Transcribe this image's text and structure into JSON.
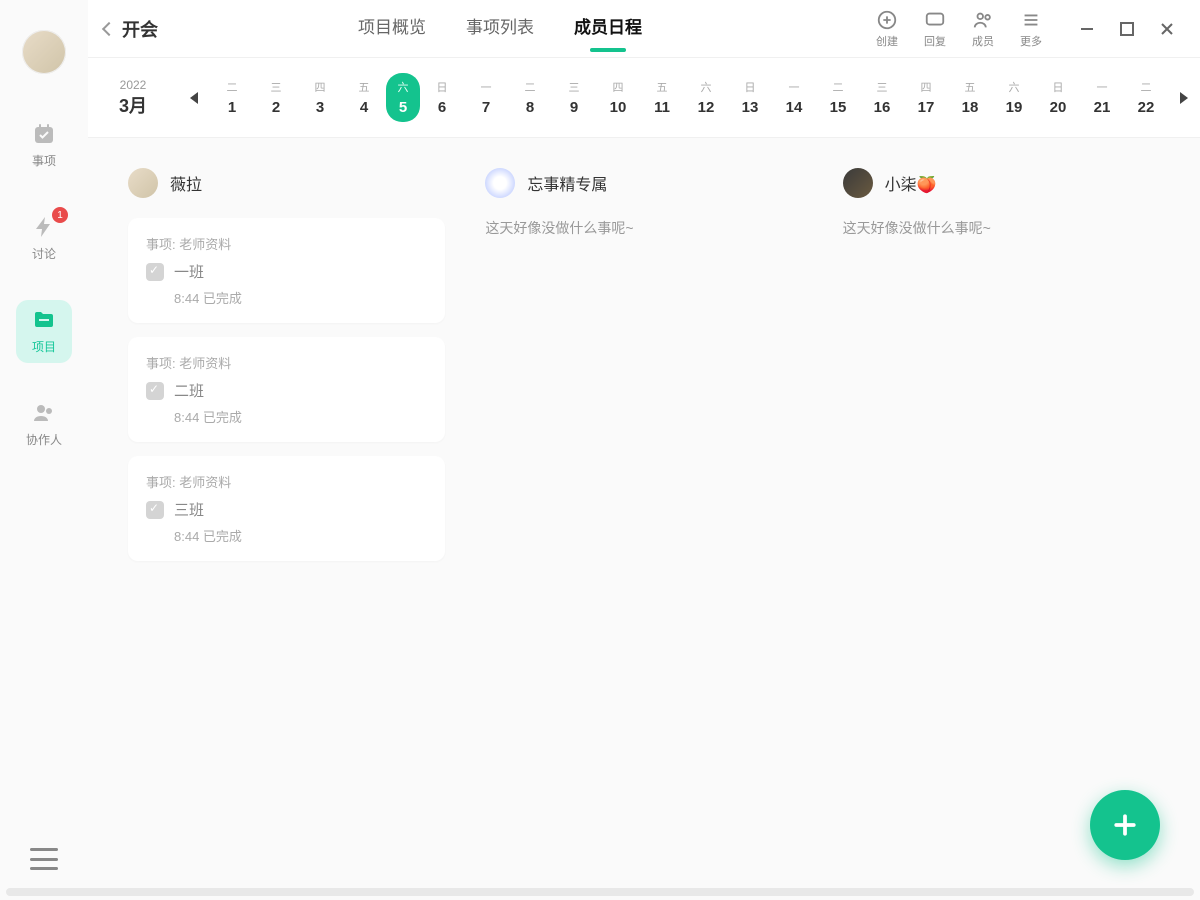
{
  "sidebar": {
    "items": [
      {
        "label": "事项"
      },
      {
        "label": "讨论",
        "badge": "1"
      },
      {
        "label": "项目"
      },
      {
        "label": "协作人"
      }
    ]
  },
  "header": {
    "title": "开会",
    "tabs": [
      "项目概览",
      "事项列表",
      "成员日程"
    ],
    "actions": [
      "创建",
      "回复",
      "成员",
      "更多"
    ]
  },
  "date": {
    "year": "2022",
    "month": "3月",
    "days": [
      {
        "dow": "二",
        "num": "1"
      },
      {
        "dow": "三",
        "num": "2"
      },
      {
        "dow": "四",
        "num": "3"
      },
      {
        "dow": "五",
        "num": "4"
      },
      {
        "dow": "六",
        "num": "5",
        "selected": true
      },
      {
        "dow": "日",
        "num": "6"
      },
      {
        "dow": "一",
        "num": "7"
      },
      {
        "dow": "二",
        "num": "8"
      },
      {
        "dow": "三",
        "num": "9"
      },
      {
        "dow": "四",
        "num": "10"
      },
      {
        "dow": "五",
        "num": "11"
      },
      {
        "dow": "六",
        "num": "12"
      },
      {
        "dow": "日",
        "num": "13"
      },
      {
        "dow": "一",
        "num": "14"
      },
      {
        "dow": "二",
        "num": "15"
      },
      {
        "dow": "三",
        "num": "16"
      },
      {
        "dow": "四",
        "num": "17"
      },
      {
        "dow": "五",
        "num": "18"
      },
      {
        "dow": "六",
        "num": "19"
      },
      {
        "dow": "日",
        "num": "20"
      },
      {
        "dow": "一",
        "num": "21"
      },
      {
        "dow": "二",
        "num": "22"
      }
    ]
  },
  "members": [
    {
      "name": "薇拉",
      "tasks": [
        {
          "project": "事项:  老师资料",
          "title": "一班",
          "status": "8:44 已完成"
        },
        {
          "project": "事项:  老师资料",
          "title": "二班",
          "status": "8:44 已完成"
        },
        {
          "project": "事项:  老师资料",
          "title": "三班",
          "status": "8:44 已完成"
        }
      ]
    },
    {
      "name": "忘事精专属",
      "empty": "这天好像没做什么事呢~"
    },
    {
      "name": "小柒🍑",
      "empty": "这天好像没做什么事呢~"
    }
  ]
}
